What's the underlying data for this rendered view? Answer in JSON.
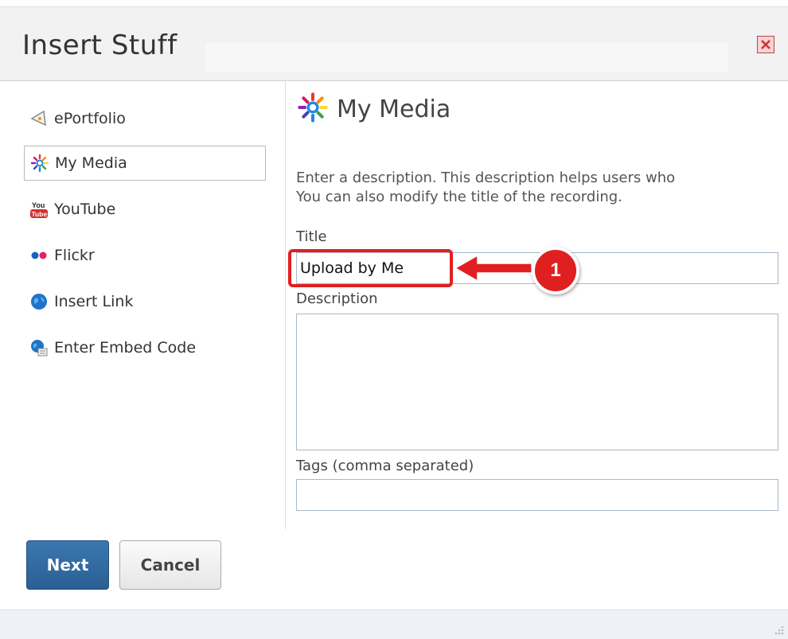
{
  "dialog": {
    "title": "Insert Stuff"
  },
  "sidebar": {
    "items": [
      {
        "label": "ePortfolio",
        "icon": "eportfolio-icon"
      },
      {
        "label": "My Media",
        "icon": "my-media-icon",
        "selected": true
      },
      {
        "label": "YouTube",
        "icon": "youtube-icon"
      },
      {
        "label": "Flickr",
        "icon": "flickr-icon"
      },
      {
        "label": "Insert Link",
        "icon": "globe-icon"
      },
      {
        "label": "Enter Embed Code",
        "icon": "embed-code-icon"
      }
    ]
  },
  "main": {
    "heading": "My Media",
    "description_line1": "Enter a description. This description helps users who",
    "description_line2": "You can also modify the title of the recording.",
    "title_label": "Title",
    "title_value": "Upload by Me",
    "description_label": "Description",
    "description_value": "",
    "tags_label": "Tags (comma separated)",
    "tags_value": ""
  },
  "annotation": {
    "badge_number": "1",
    "color": "#e02020"
  },
  "buttons": {
    "next": "Next",
    "cancel": "Cancel"
  },
  "colors": {
    "primary_button": "#2f6aa3",
    "titlebar": "#f2f2f2",
    "footer": "#eef1f5"
  }
}
